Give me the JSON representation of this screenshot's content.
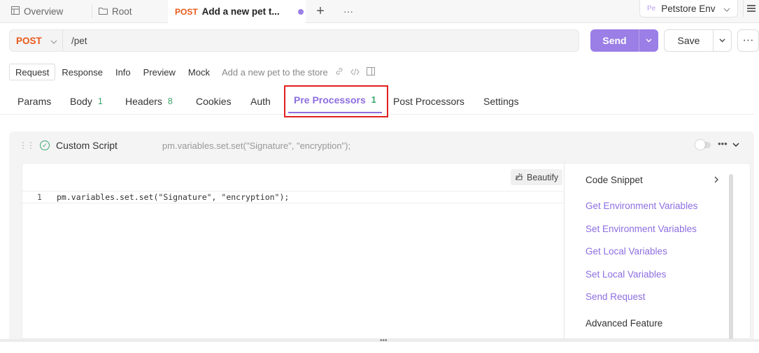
{
  "tabs": [
    {
      "label": "Overview",
      "icon": "layout-icon"
    },
    {
      "label": "Root",
      "icon": "folder-icon"
    },
    {
      "method": "POST",
      "label": "Add a new pet t..."
    }
  ],
  "tabbar": {
    "add": "+",
    "more": "···"
  },
  "env": {
    "badge": "Pe",
    "label": "Petstore Env"
  },
  "url": {
    "method": "POST",
    "path": "/pet"
  },
  "actions": {
    "send": "Send",
    "save": "Save",
    "more": "···"
  },
  "modes": [
    "Request",
    "Response",
    "Info",
    "Preview",
    "Mock"
  ],
  "mode_description": "Add a new pet to the store",
  "request_tabs": [
    {
      "label": "Params",
      "count": ""
    },
    {
      "label": "Body",
      "count": "1"
    },
    {
      "label": "Headers",
      "count": "8"
    },
    {
      "label": "Cookies",
      "count": ""
    },
    {
      "label": "Auth",
      "count": ""
    },
    {
      "label": "Pre Processors",
      "count": "1"
    },
    {
      "label": "Post Processors",
      "count": ""
    },
    {
      "label": "Settings",
      "count": ""
    }
  ],
  "script": {
    "title": "Custom Script",
    "preview": "pm.variables.set.set(\"Signature\", \"encryption\");",
    "beautify": "Beautify",
    "line_number": "1",
    "code": "pm.variables.set.set(\"Signature\", \"encryption\");"
  },
  "snippets": {
    "header": "Code Snippet",
    "items": [
      "Get Environment Variables",
      "Set Environment Variables",
      "Get Local Variables",
      "Set Local Variables",
      "Send Request"
    ],
    "advanced": "Advanced Feature"
  },
  "colors": {
    "accent": "#9b7ee6",
    "post": "#e8591a",
    "count": "#3aa66a",
    "highlight": "#e02020"
  }
}
